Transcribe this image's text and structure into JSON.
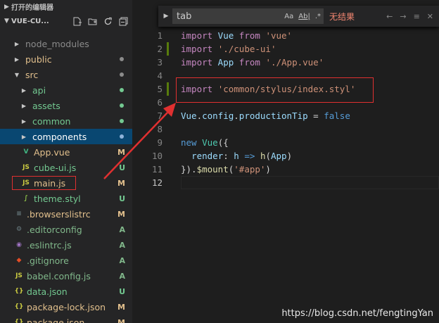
{
  "sidebar": {
    "open_editors_label": "打开的编辑器",
    "project_label": "VUE-CU...",
    "icons": [
      "new-file-icon",
      "new-folder-icon",
      "refresh-icon",
      "collapse-all-icon"
    ],
    "tree": [
      {
        "name": "node_modules",
        "type": "folder",
        "depth": 1,
        "expanded": false,
        "status": "",
        "dot": "",
        "color": "#8b8b8b"
      },
      {
        "name": "public",
        "type": "folder",
        "depth": 1,
        "expanded": false,
        "status": "",
        "dot": "#8b8b8b",
        "color": "#e2c08d"
      },
      {
        "name": "src",
        "type": "folder",
        "depth": 1,
        "expanded": true,
        "status": "",
        "dot": "#8b8b8b",
        "color": "#e2c08d"
      },
      {
        "name": "api",
        "type": "folder",
        "depth": 2,
        "expanded": false,
        "status": "",
        "dot": "#73c991",
        "color": "#73c991"
      },
      {
        "name": "assets",
        "type": "folder",
        "depth": 2,
        "expanded": false,
        "status": "",
        "dot": "#73c991",
        "color": "#73c991"
      },
      {
        "name": "common",
        "type": "folder",
        "depth": 2,
        "expanded": false,
        "status": "",
        "dot": "#73c991",
        "color": "#73c991"
      },
      {
        "name": "components",
        "type": "folder",
        "depth": 2,
        "expanded": false,
        "status": "",
        "dot": "#8fb3d9",
        "color": "#ffffff",
        "selected": true
      },
      {
        "name": "App.vue",
        "type": "vue",
        "depth": 2,
        "status": "M",
        "color": "#e2c08d"
      },
      {
        "name": "cube-ui.js",
        "type": "js",
        "depth": 2,
        "status": "U",
        "color": "#73c991"
      },
      {
        "name": "main.js",
        "type": "js",
        "depth": 2,
        "status": "M",
        "color": "#e2c08d"
      },
      {
        "name": "theme.styl",
        "type": "styl",
        "depth": 2,
        "status": "U",
        "color": "#73c991"
      },
      {
        "name": ".browserslistrc",
        "type": "generic",
        "depth": 1,
        "status": "M",
        "color": "#e2c08d"
      },
      {
        "name": ".editorconfig",
        "type": "gear",
        "depth": 1,
        "status": "A",
        "color": "#81b88b"
      },
      {
        "name": ".eslintrc.js",
        "type": "eslint",
        "depth": 1,
        "status": "A",
        "color": "#81b88b"
      },
      {
        "name": ".gitignore",
        "type": "git",
        "depth": 1,
        "status": "A",
        "color": "#81b88b"
      },
      {
        "name": "babel.config.js",
        "type": "js",
        "depth": 1,
        "status": "A",
        "color": "#81b88b"
      },
      {
        "name": "data.json",
        "type": "json",
        "depth": 1,
        "status": "U",
        "color": "#73c991"
      },
      {
        "name": "package-lock.json",
        "type": "json",
        "depth": 1,
        "status": "M",
        "color": "#e2c08d"
      },
      {
        "name": "package.json",
        "type": "json",
        "depth": 1,
        "status": "M",
        "color": "#e2c08d"
      }
    ]
  },
  "find_widget": {
    "query": "tab",
    "option_match_case": "Aa",
    "option_whole_word": "Ab|",
    "option_regex": ".*",
    "result_text": "无结果",
    "prev_icon": "arrow-up-icon",
    "next_icon": "arrow-down-icon",
    "selection_icon": "find-in-selection-icon",
    "close_icon": "close-icon"
  },
  "editor": {
    "line_numbers": [
      "1",
      "2",
      "3",
      "4",
      "5",
      "6",
      "7",
      "8",
      "9",
      "10",
      "11",
      "12"
    ],
    "lines": [
      [
        {
          "t": "import",
          "c": "kw"
        },
        {
          "t": " Vue ",
          "c": "id"
        },
        {
          "t": "from",
          "c": "kw"
        },
        {
          "t": " ",
          "c": ""
        },
        {
          "t": "'vue'",
          "c": "str"
        }
      ],
      [
        {
          "t": "import",
          "c": "kw"
        },
        {
          "t": " ",
          "c": ""
        },
        {
          "t": "'./cube-ui'",
          "c": "str"
        }
      ],
      [
        {
          "t": "import",
          "c": "kw"
        },
        {
          "t": " App ",
          "c": "id"
        },
        {
          "t": "from",
          "c": "kw"
        },
        {
          "t": " ",
          "c": ""
        },
        {
          "t": "'./App.vue'",
          "c": "str"
        }
      ],
      [],
      [
        {
          "t": "import",
          "c": "kw"
        },
        {
          "t": " ",
          "c": ""
        },
        {
          "t": "'common/stylus/index.styl'",
          "c": "str"
        }
      ],
      [],
      [
        {
          "t": "Vue",
          "c": "id"
        },
        {
          "t": ".",
          "c": ""
        },
        {
          "t": "config",
          "c": "id"
        },
        {
          "t": ".",
          "c": ""
        },
        {
          "t": "productionTip",
          "c": "id"
        },
        {
          "t": " = ",
          "c": ""
        },
        {
          "t": "false",
          "c": "kw2"
        }
      ],
      [],
      [
        {
          "t": "new",
          "c": "kw2"
        },
        {
          "t": " ",
          "c": ""
        },
        {
          "t": "Vue",
          "c": "cls"
        },
        {
          "t": "({",
          "c": ""
        }
      ],
      [
        {
          "t": "  ",
          "c": ""
        },
        {
          "t": "render",
          "c": "id"
        },
        {
          "t": ": ",
          "c": ""
        },
        {
          "t": "h",
          "c": "id"
        },
        {
          "t": " ",
          "c": ""
        },
        {
          "t": "=>",
          "c": "kw2"
        },
        {
          "t": " ",
          "c": ""
        },
        {
          "t": "h",
          "c": "fn"
        },
        {
          "t": "(",
          "c": ""
        },
        {
          "t": "App",
          "c": "id"
        },
        {
          "t": ")",
          "c": ""
        }
      ],
      [
        {
          "t": "}).",
          "c": ""
        },
        {
          "t": "$mount",
          "c": "fn"
        },
        {
          "t": "(",
          "c": ""
        },
        {
          "t": "'#app'",
          "c": "str"
        },
        {
          "t": ")",
          "c": ""
        }
      ],
      []
    ],
    "modified_lines": [
      2,
      5
    ]
  },
  "watermark": "https://blog.csdn.net/fengtingYan"
}
